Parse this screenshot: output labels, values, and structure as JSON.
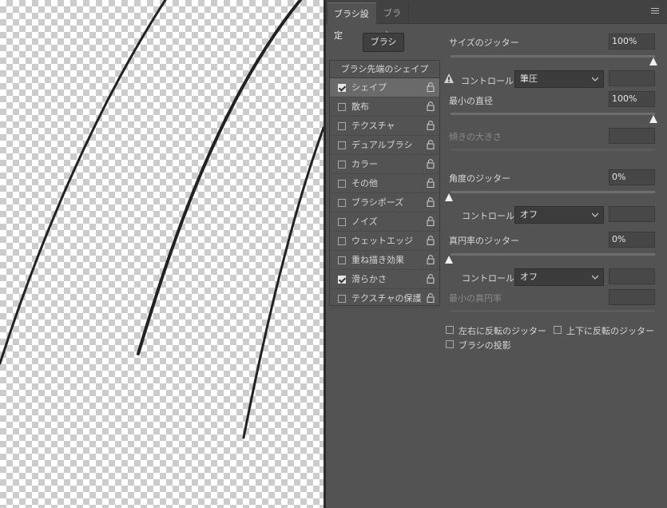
{
  "tabs": [
    {
      "label": "ブラシ設定"
    },
    {
      "label": "ブラシ"
    }
  ],
  "brushes_button": "ブラシ",
  "list_header": "ブラシ先端のシェイプ",
  "list_items": [
    {
      "label": "シェイプ",
      "checked": true,
      "selected": true
    },
    {
      "label": "散布",
      "checked": false
    },
    {
      "label": "テクスチャ",
      "checked": false
    },
    {
      "label": "デュアルブラシ",
      "checked": false
    },
    {
      "label": "カラー",
      "checked": false
    },
    {
      "label": "その他",
      "checked": false
    },
    {
      "label": "ブラシポーズ",
      "checked": false
    },
    {
      "label": "ノイズ",
      "checked": false
    },
    {
      "label": "ウェットエッジ",
      "checked": false
    },
    {
      "label": "重ね描き効果",
      "checked": false
    },
    {
      "label": "滑らかさ",
      "checked": true
    },
    {
      "label": "テクスチャの保護",
      "checked": false
    }
  ],
  "controls": {
    "size_jitter": {
      "label": "サイズのジッター",
      "value": "100%"
    },
    "size_control": {
      "label": "コントロール：",
      "value": "筆圧"
    },
    "min_diameter": {
      "label": "最小の直径",
      "value": "100%"
    },
    "tilt_scale": {
      "label": "傾きの大きさ"
    },
    "angle_jitter": {
      "label": "角度のジッター",
      "value": "0%"
    },
    "angle_control": {
      "label": "コントロール：",
      "value": "オフ"
    },
    "roundness_jitter": {
      "label": "真円率のジッター",
      "value": "0%"
    },
    "roundness_control": {
      "label": "コントロール：",
      "value": "オフ"
    },
    "min_roundness": {
      "label": "最小の真円率"
    },
    "flip_x": {
      "label": "左右に反転のジッター"
    },
    "flip_y": {
      "label": "上下に反転のジッター"
    },
    "projection": {
      "label": "ブラシの投影"
    }
  },
  "colors": {
    "panel": "#535353",
    "stroke": "#1e1e1e"
  }
}
